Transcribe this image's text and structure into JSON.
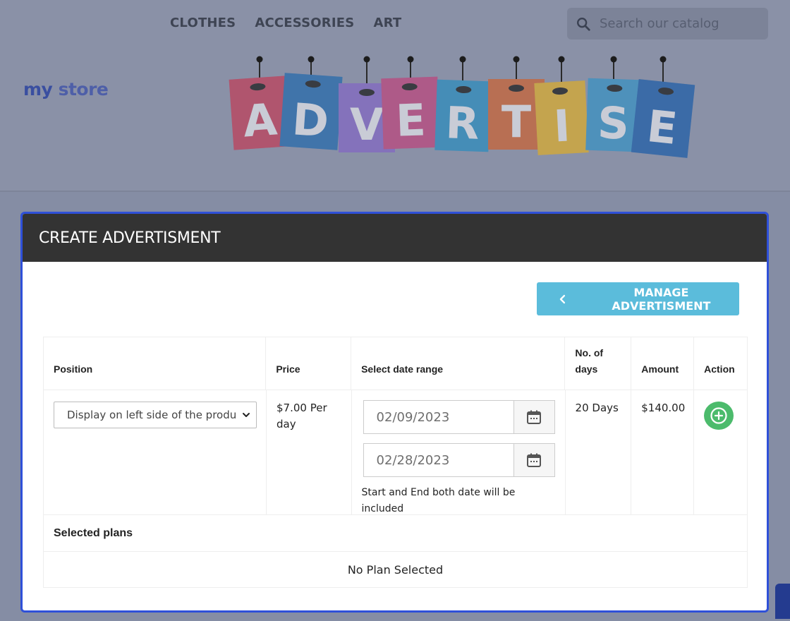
{
  "header": {
    "nav": [
      "CLOTHES",
      "ACCESSORIES",
      "ART"
    ],
    "search_placeholder": "Search our catalog",
    "logo_words": [
      "my",
      "store"
    ],
    "banner_letters": [
      "A",
      "D",
      "V",
      "E",
      "R",
      "T",
      "I",
      "S",
      "E"
    ],
    "banner_colors": [
      "#c7445f",
      "#2b6fb2",
      "#8a6cc9",
      "#c44b83",
      "#3392c4",
      "#d2683a",
      "#e2b233",
      "#3f97c9",
      "#2563ad"
    ]
  },
  "modal": {
    "title": "CREATE ADVERTISMENT",
    "manage_button": "MANAGE ADVERTISMENT",
    "columns": [
      "Position",
      "Price",
      "Select date range",
      "No. of days",
      "Amount",
      "Action"
    ],
    "row": {
      "position": "Display on left side of the product page",
      "price": "$7.00 Per day",
      "start_date": "02/09/2023",
      "end_date": "02/28/2023",
      "date_hint": "Start and End both date will be included",
      "days": "20 Days",
      "amount": "$140.00"
    },
    "selected_plans_label": "Selected plans",
    "no_plan_text": "No Plan Selected"
  },
  "colors": {
    "modal_border": "#2f50d8",
    "modal_header": "#333333",
    "manage_button": "#5bbcdb",
    "add_button": "#4cbb6c"
  }
}
